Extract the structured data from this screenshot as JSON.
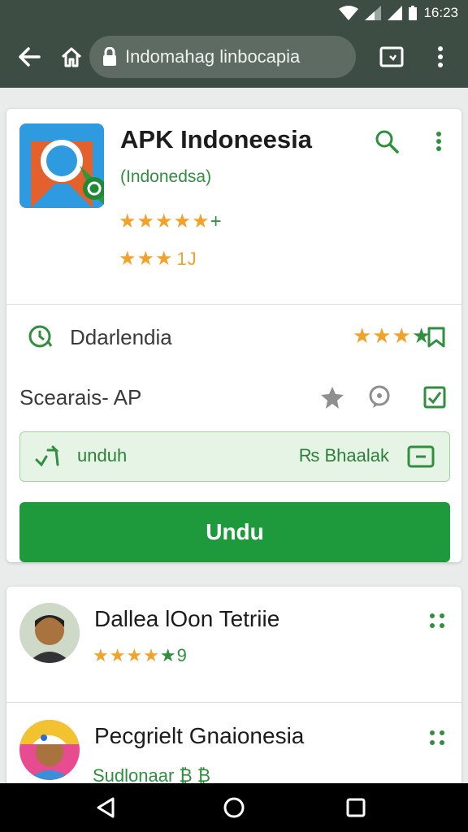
{
  "status": {
    "time": "16:23"
  },
  "browser": {
    "url": "Indomahag linbocapia"
  },
  "app": {
    "title": "APK Indoneesia",
    "subtitle": "(Indonedsa)",
    "rating_stars": "★★★★★",
    "rating_extra": "+",
    "rating2_stars": "★★★",
    "rating2_count": "1J"
  },
  "rows": {
    "developer": "Ddarlendia",
    "category": "Scearais- AP"
  },
  "download": {
    "label": "unduh",
    "size": "₨ Bhaalak",
    "button": "Undu"
  },
  "list": [
    {
      "title": "Dallea lOon Tetriie",
      "stars": "★★★★",
      "extra": "★9"
    },
    {
      "title": "Pecgrielt Gnaionesia",
      "stars": "",
      "extra": "Sudlonaar ₿ ₿"
    }
  ],
  "colors": {
    "accent": "#1e9a3d",
    "toolbar": "#3d4d44",
    "star": "#f0a22a"
  }
}
